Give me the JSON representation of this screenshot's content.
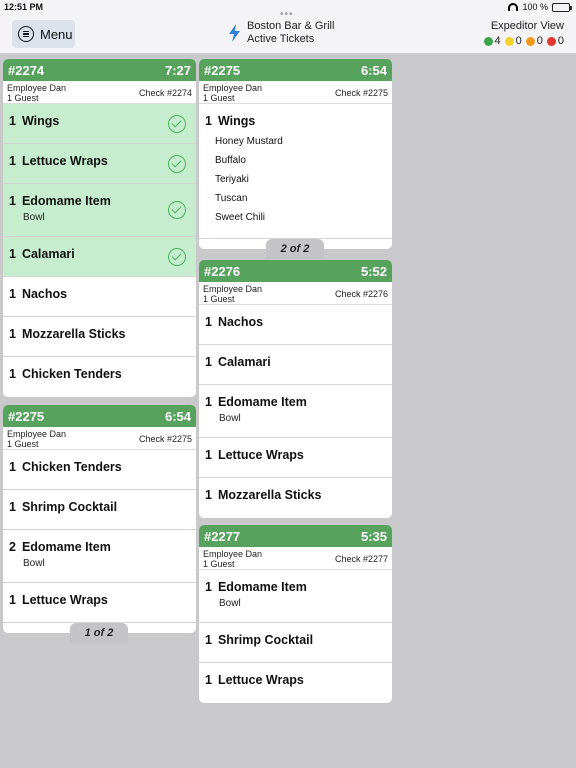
{
  "status": {
    "time": "12:51 PM",
    "battery": "100 %"
  },
  "nav": {
    "menu_label": "Menu",
    "restaurant": "Boston Bar & Grill",
    "subtitle": "Active Tickets",
    "view_label": "Expeditor View",
    "counts": [
      {
        "color": "#3aa54a",
        "value": "4"
      },
      {
        "color": "#f3d22c",
        "value": "0"
      },
      {
        "color": "#f29a1d",
        "value": "0"
      },
      {
        "color": "#e2362f",
        "value": "0"
      }
    ]
  },
  "colors": {
    "header": "#57a35d",
    "done": "#c6eece",
    "background": "#c9c9cc"
  },
  "tickets": [
    {
      "number": "#2274",
      "time": "7:27",
      "employee": "Employee Dan",
      "guests": "1 Guest",
      "check": "Check #2274",
      "items": [
        {
          "qty": "1",
          "name": "Wings",
          "done": true
        },
        {
          "qty": "1",
          "name": "Lettuce Wraps",
          "done": true
        },
        {
          "qty": "1",
          "name": "Edomame Item",
          "mod": "Bowl",
          "done": true
        },
        {
          "qty": "1",
          "name": "Calamari",
          "done": true
        },
        {
          "qty": "1",
          "name": "Nachos"
        },
        {
          "qty": "1",
          "name": "Mozzarella Sticks"
        },
        {
          "qty": "1",
          "name": "Chicken Tenders"
        }
      ]
    },
    {
      "number": "#2275",
      "time": "6:54",
      "employee": "Employee Dan",
      "guests": "1 Guest",
      "check": "Check #2275",
      "pager": "1 of 2",
      "items": [
        {
          "qty": "1",
          "name": "Chicken Tenders"
        },
        {
          "qty": "1",
          "name": "Shrimp Cocktail"
        },
        {
          "qty": "2",
          "name": "Edomame Item",
          "mod": "Bowl"
        },
        {
          "qty": "1",
          "name": "Lettuce Wraps"
        }
      ]
    },
    {
      "number": "#2275",
      "time": "6:54",
      "employee": "Employee Dan",
      "guests": "1 Guest",
      "check": "Check #2275",
      "pager": "2 of 2",
      "items": [
        {
          "qty": "1",
          "name": "Wings",
          "mods": [
            "Honey Mustard",
            "Buffalo",
            "Teriyaki",
            "Tuscan",
            "Sweet Chili"
          ]
        }
      ]
    },
    {
      "number": "#2276",
      "time": "5:52",
      "employee": "Employee Dan",
      "guests": "1 Guest",
      "check": "Check #2276",
      "items": [
        {
          "qty": "1",
          "name": "Nachos"
        },
        {
          "qty": "1",
          "name": "Calamari"
        },
        {
          "qty": "1",
          "name": "Edomame Item",
          "mod": "Bowl"
        },
        {
          "qty": "1",
          "name": "Lettuce Wraps"
        },
        {
          "qty": "1",
          "name": "Mozzarella Sticks"
        }
      ]
    },
    {
      "number": "#2277",
      "time": "5:35",
      "employee": "Employee Dan",
      "guests": "1 Guest",
      "check": "Check #2277",
      "items": [
        {
          "qty": "1",
          "name": "Edomame Item",
          "mod": "Bowl"
        },
        {
          "qty": "1",
          "name": "Shrimp Cocktail"
        },
        {
          "qty": "1",
          "name": "Lettuce Wraps"
        }
      ]
    }
  ]
}
